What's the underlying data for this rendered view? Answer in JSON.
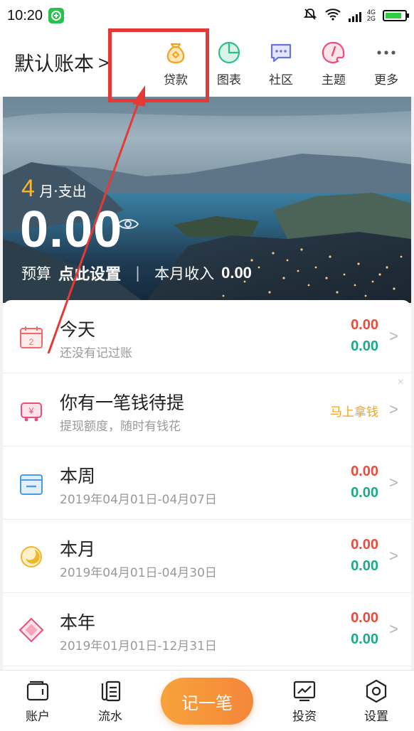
{
  "status_bar": {
    "time": "10:20",
    "network_top": "4G",
    "network_bottom": "2G"
  },
  "header": {
    "book_title": "默认账本",
    "book_chevron": ">",
    "nav": [
      {
        "label": "贷款",
        "icon": "money-bag-icon"
      },
      {
        "label": "图表",
        "icon": "pie-chart-icon"
      },
      {
        "label": "社区",
        "icon": "chat-icon"
      },
      {
        "label": "主题",
        "icon": "palette-icon"
      },
      {
        "label": "更多",
        "icon": "more-dots-icon"
      }
    ]
  },
  "summary": {
    "month_number": "4",
    "month_label": "月·支出",
    "expense": "0.00",
    "budget_label": "预算",
    "budget_value": "点此设置",
    "separator": "|",
    "income_label": "本月收入",
    "income_value": "0.00"
  },
  "rows": [
    {
      "title": "今天",
      "sub": "还没有记过账",
      "expense": "0.00",
      "income": "0.00"
    },
    {
      "title": "你有一笔钱待提",
      "sub": "提现额度，随时有钱花",
      "action": "马上拿钱",
      "close": "×"
    },
    {
      "title": "本周",
      "sub": "2019年04月01日-04月07日",
      "expense": "0.00",
      "income": "0.00"
    },
    {
      "title": "本月",
      "sub": "2019年04月01日-04月30日",
      "expense": "0.00",
      "income": "0.00"
    },
    {
      "title": "本年",
      "sub": "2019年01月01日-12月31日",
      "expense": "0.00",
      "income": "0.00"
    }
  ],
  "calendar_day": "2",
  "chevron": ">",
  "tabbar": {
    "account": "账户",
    "flow": "流水",
    "record": "记一笔",
    "invest": "投资",
    "settings": "设置"
  },
  "colors": {
    "expense": "#e74c3c",
    "income": "#1aa98a",
    "accent": "#f5863a",
    "highlight": "#e53935"
  }
}
